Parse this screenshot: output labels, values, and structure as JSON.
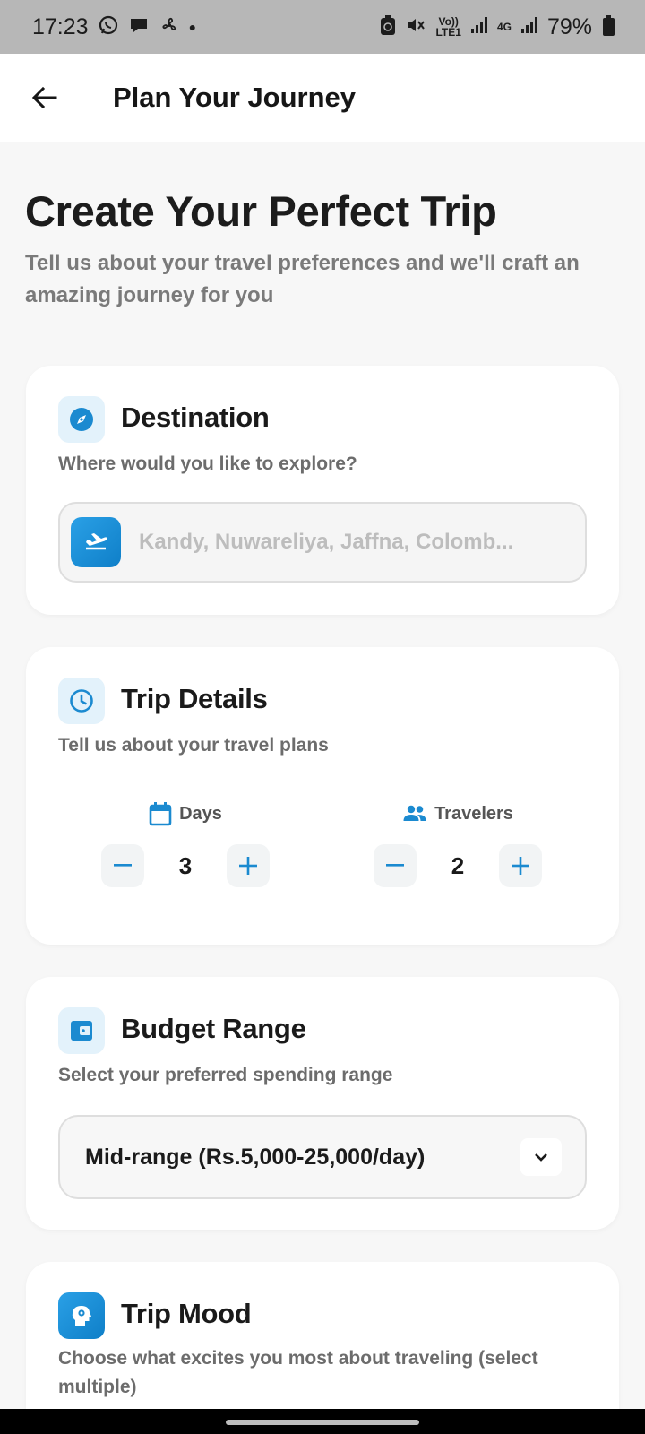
{
  "status_bar": {
    "time": "17:23",
    "notifications": [
      "whatsapp-icon",
      "chat-icon",
      "fan-icon"
    ],
    "volte": "Vo))\nLTE1",
    "network": "4G",
    "battery": "79%"
  },
  "app_bar": {
    "title": "Plan Your Journey"
  },
  "hero": {
    "title": "Create Your Perfect Trip",
    "subtitle": "Tell us about your travel preferences and we'll craft an amazing journey for you"
  },
  "destination": {
    "title": "Destination",
    "subtitle": "Where would you like to explore?",
    "placeholder": "Kandy, Nuwareliya, Jaffna, Colomb...",
    "value": ""
  },
  "trip_details": {
    "title": "Trip Details",
    "subtitle": "Tell us about your travel plans",
    "days_label": "Days",
    "days_value": "3",
    "travelers_label": "Travelers",
    "travelers_value": "2"
  },
  "budget": {
    "title": "Budget Range",
    "subtitle": "Select your preferred spending range",
    "selected": "Mid-range (Rs.5,000-25,000/day)"
  },
  "mood": {
    "title": "Trip Mood",
    "subtitle": "Choose what excites you most about traveling (select multiple)"
  },
  "colors": {
    "accent": "#1b8ad0",
    "icon_bg": "#e3f2fb",
    "background": "#f7f7f7"
  }
}
